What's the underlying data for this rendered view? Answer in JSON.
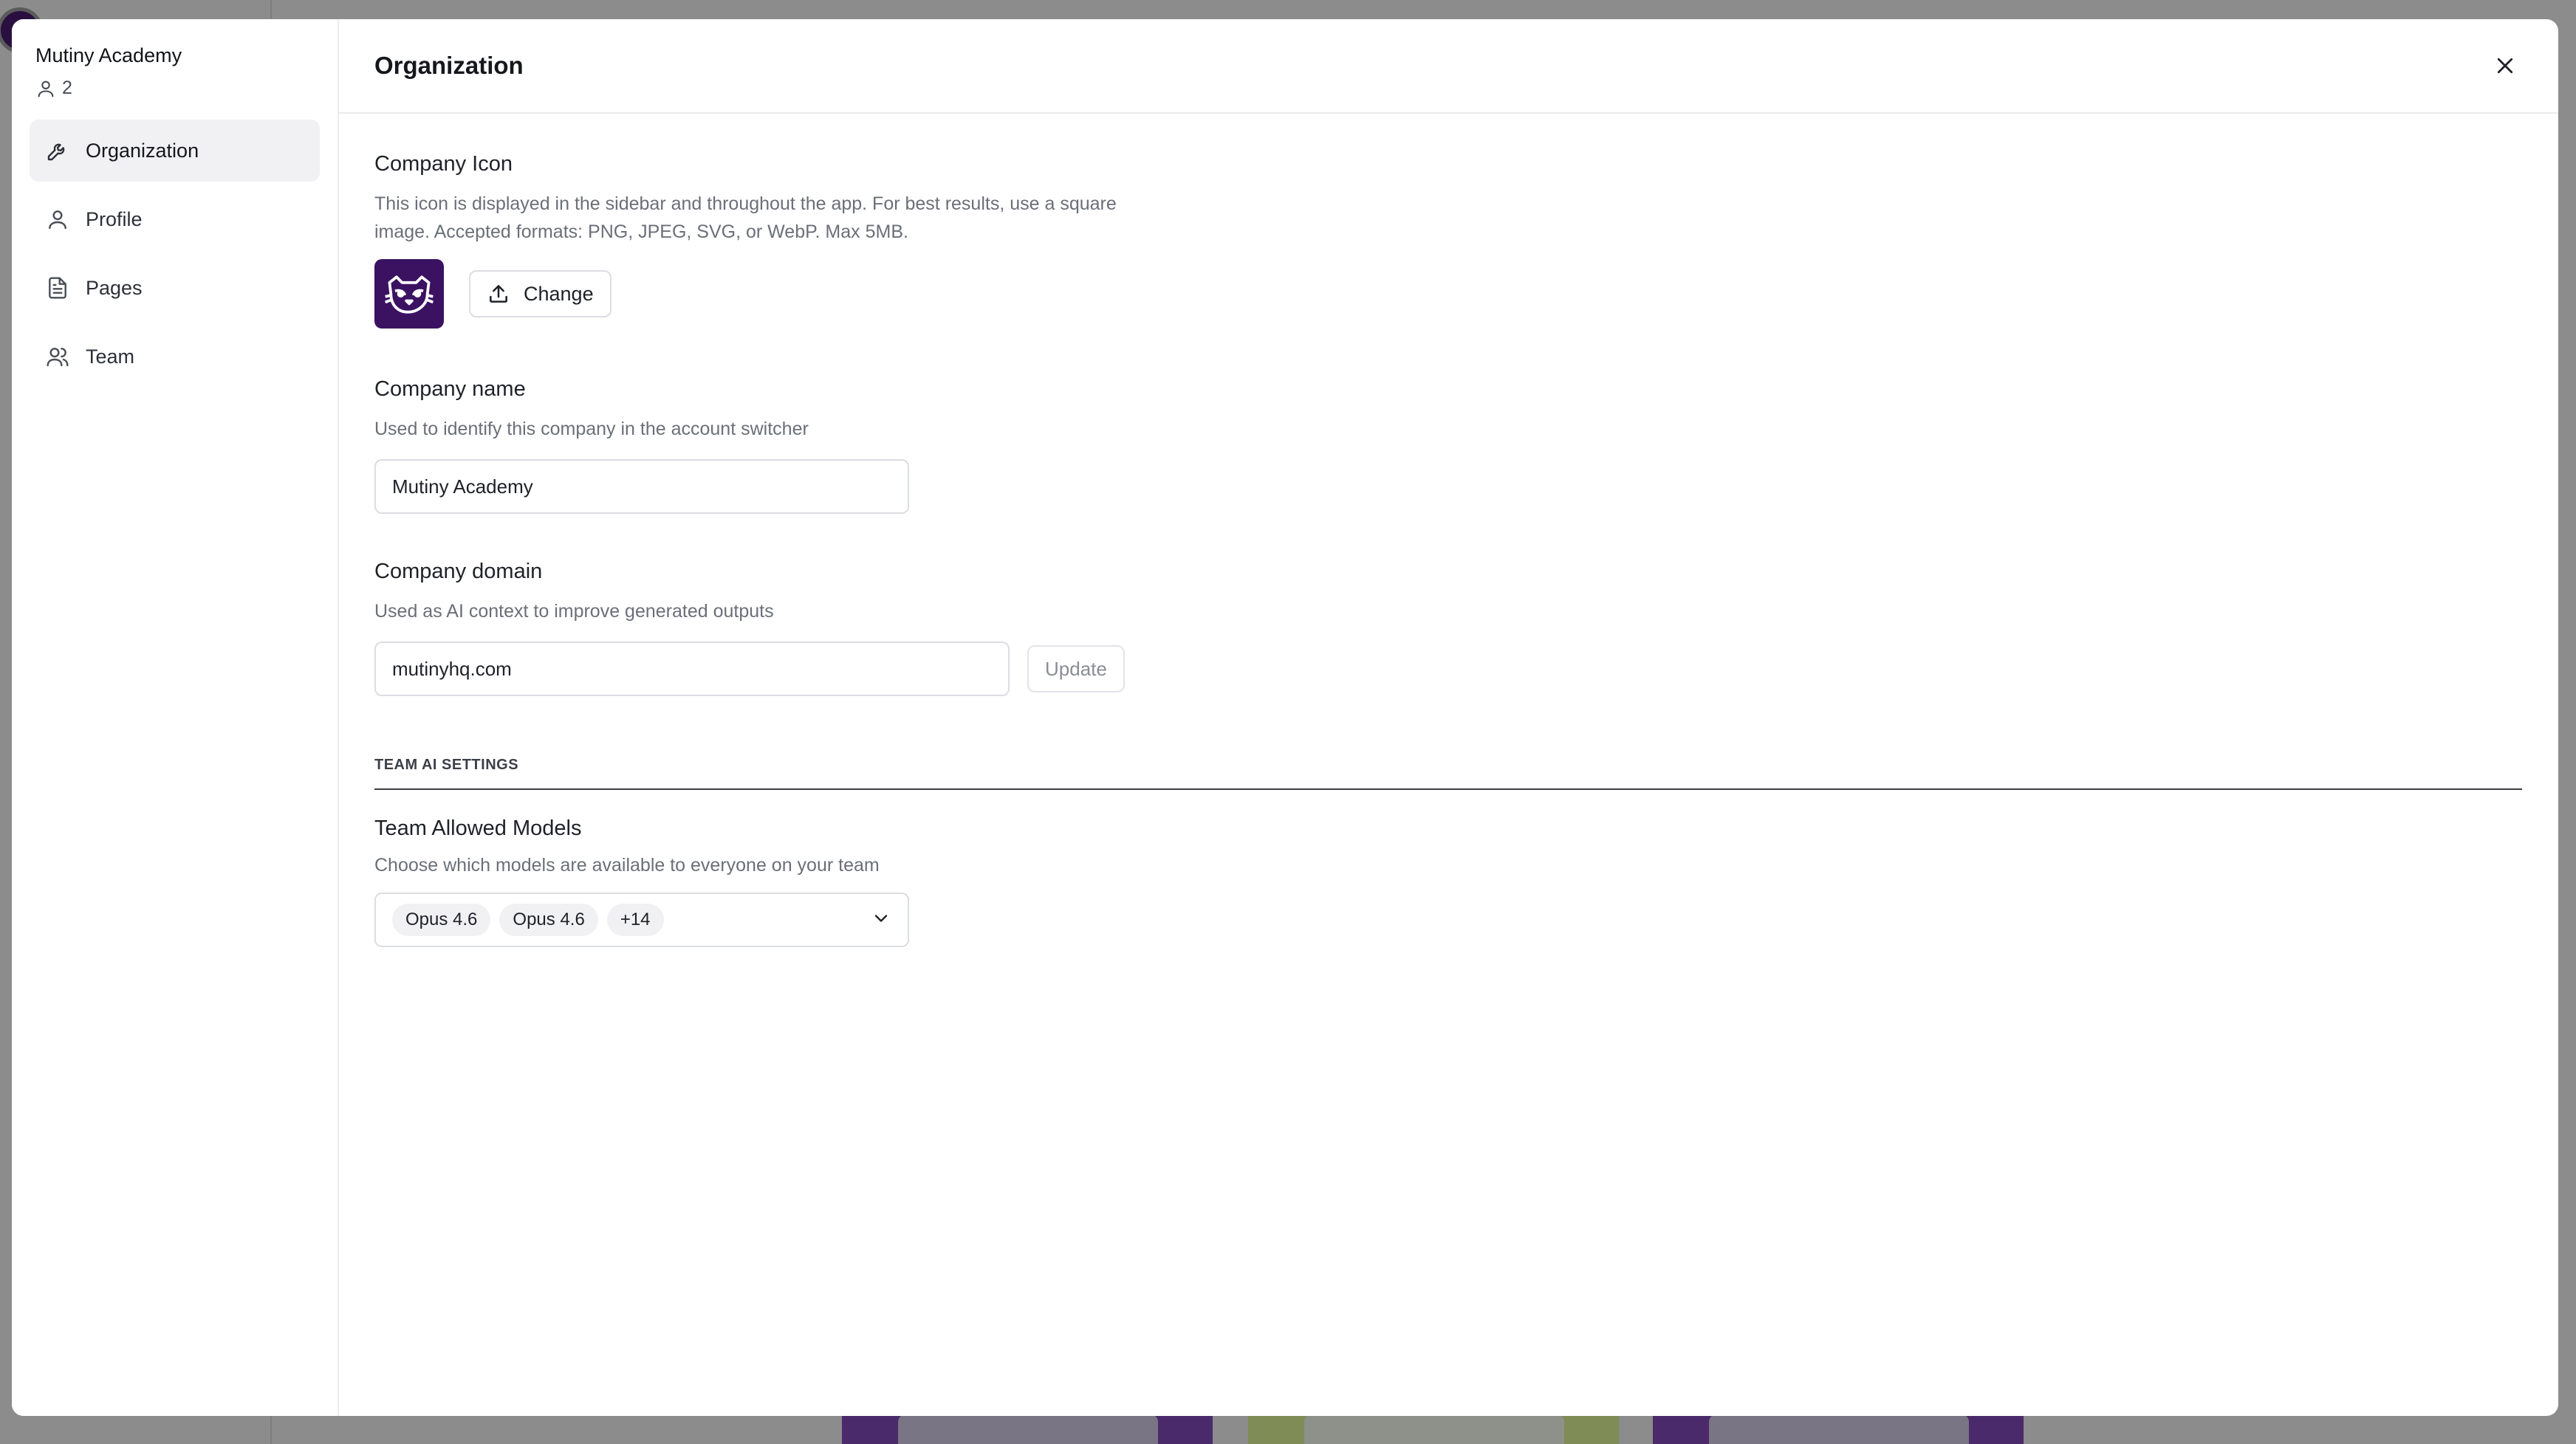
{
  "sidebar": {
    "org_name": "Mutiny Academy",
    "member_count": "2",
    "items": [
      {
        "label": "Organization",
        "icon": "wrench-icon",
        "active": true
      },
      {
        "label": "Profile",
        "icon": "user-icon",
        "active": false
      },
      {
        "label": "Pages",
        "icon": "document-icon",
        "active": false
      },
      {
        "label": "Team",
        "icon": "users-icon",
        "active": false
      }
    ]
  },
  "header": {
    "title": "Organization"
  },
  "company_icon": {
    "title": "Company Icon",
    "description": "This icon is displayed in the sidebar and throughout the app. For best results, use a square image. Accepted formats: PNG, JPEG, SVG, or WebP. Max 5MB.",
    "change_label": "Change"
  },
  "company_name": {
    "title": "Company name",
    "description": "Used to identify this company in the account switcher",
    "value": "Mutiny Academy"
  },
  "company_domain": {
    "title": "Company domain",
    "description": "Used as AI context to improve generated outputs",
    "value": "mutinyhq.com",
    "update_label": "Update"
  },
  "team_ai": {
    "section_label": "TEAM AI SETTINGS",
    "models_title": "Team Allowed Models",
    "models_description": "Choose which models are available to everyone on your team",
    "chips": [
      "Opus 4.6",
      "Opus 4.6",
      "+14"
    ]
  },
  "colors": {
    "accent": "#3b1262",
    "overlay": "#8c8c8c"
  }
}
